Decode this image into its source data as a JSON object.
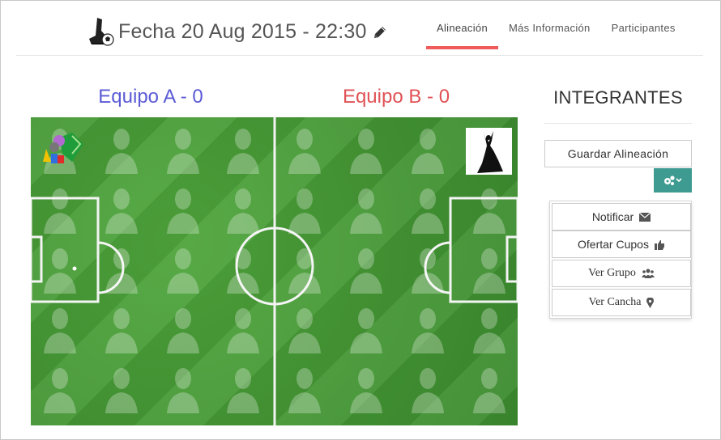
{
  "header": {
    "title": "Fecha 20 Aug 2015 - 22:30",
    "logo_icon": "soccer-boot-ball-icon",
    "edit_icon": "pencil-icon"
  },
  "nav": {
    "tabs": [
      {
        "label": "Alineación",
        "active": true
      },
      {
        "label": "Más Información",
        "active": false
      },
      {
        "label": "Participantes",
        "active": false
      }
    ],
    "active_color": "#ef5b5b"
  },
  "teams": {
    "a": {
      "label": "Equipo A - 0",
      "color": "#5b5bd6",
      "logo_icon": "team-a-logo-icon"
    },
    "b": {
      "label": "Equipo B - 0",
      "color": "#e05256",
      "logo_icon": "team-b-dancer-logo-icon"
    }
  },
  "pitch": {
    "grass_color": "#438f33",
    "empty_slot_icon": "player-silhouette-icon"
  },
  "panel": {
    "title": "INTEGRANTES",
    "save_label": "Guardar Alineación",
    "gear_icon": "cogs-icon",
    "gear_color": "#3d9b91",
    "menu": [
      {
        "label": "Notificar",
        "icon": "envelope-icon"
      },
      {
        "label": "Ofertar Cupos",
        "icon": "thumbs-up-icon"
      },
      {
        "label": "Ver Grupo",
        "icon": "users-icon"
      },
      {
        "label": "Ver Cancha",
        "icon": "map-marker-icon"
      }
    ]
  }
}
